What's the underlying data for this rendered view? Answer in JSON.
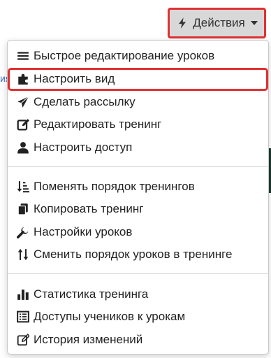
{
  "background": {
    "link_fragment": "ия"
  },
  "actions_button": {
    "label": "Действия",
    "icon": "bolt-icon"
  },
  "menu": {
    "group1": [
      {
        "label": "Быстрое редактирование уроков",
        "icon": "bars-icon"
      },
      {
        "label": "Настроить вид",
        "icon": "puzzle-icon"
      },
      {
        "label": "Сделать рассылку",
        "icon": "paper-plane-icon"
      },
      {
        "label": "Редактировать тренинг",
        "icon": "edit-icon"
      },
      {
        "label": "Настроить доступ",
        "icon": "user-icon"
      }
    ],
    "group2": [
      {
        "label": "Поменять порядок тренингов",
        "icon": "sort-amount-icon"
      },
      {
        "label": "Копировать тренинг",
        "icon": "copy-icon"
      },
      {
        "label": "Настройки уроков",
        "icon": "wrench-icon"
      },
      {
        "label": "Сменить порядок уроков в тренинге",
        "icon": "sort-arrows-icon"
      }
    ],
    "group3": [
      {
        "label": "Статистика тренинга",
        "icon": "bar-chart-icon"
      },
      {
        "label": "Доступы учеников к урокам",
        "icon": "list-icon"
      },
      {
        "label": "История изменений",
        "icon": "edit-outline-icon"
      }
    ]
  },
  "colors": {
    "highlight": "#e03131",
    "button_bg": "#d8d8d8"
  }
}
